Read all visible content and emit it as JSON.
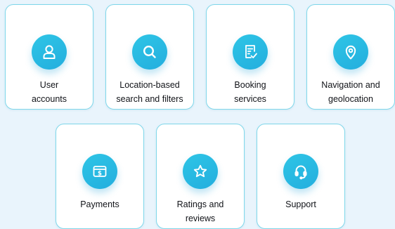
{
  "features": [
    {
      "icon": "user-icon",
      "line1": "User",
      "line2": "accounts"
    },
    {
      "icon": "search-icon",
      "line1": "Location-based",
      "line2": "search and filters"
    },
    {
      "icon": "booking-document-icon",
      "line1": "Booking",
      "line2": "services"
    },
    {
      "icon": "map-pin-icon",
      "line1": "Navigation and",
      "line2": "geolocation"
    },
    {
      "icon": "payment-card-dollar-icon",
      "line1": "Payments",
      "line2": ""
    },
    {
      "icon": "star-icon",
      "line1": "Ratings and",
      "line2": "reviews"
    },
    {
      "icon": "headset-icon",
      "line1": "Support",
      "line2": ""
    }
  ],
  "colors": {
    "background": "#e9f4fc",
    "card_border": "#7fd7ea",
    "icon_gradient_start": "#2ec5e6",
    "icon_gradient_end": "#23aede",
    "text": "#111318"
  }
}
